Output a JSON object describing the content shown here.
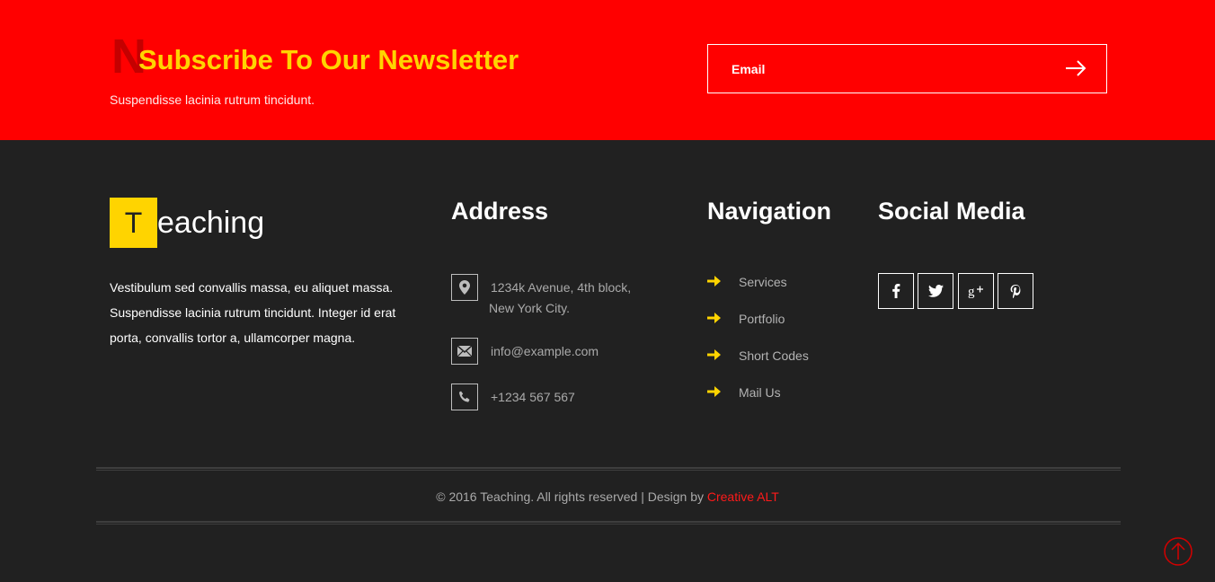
{
  "newsletter": {
    "big_letter": "N",
    "title": "Subscribe To Our Newsletter",
    "subtitle": "Suspendisse lacinia rutrum tincidunt.",
    "email_placeholder": "Email",
    "submit_icon": "arrow-right-icon"
  },
  "brand": {
    "logo_letter": "T",
    "logo_rest": "eaching",
    "description": "Vestibulum sed convallis massa, eu aliquet massa. Suspendisse lacinia rutrum tincidunt. Integer id erat porta, convallis tortor a, ullamcorper magna."
  },
  "address": {
    "title": "Address",
    "location_line1": "1234k Avenue, 4th block,",
    "location_line2": "New York City.",
    "email": "info@example.com",
    "phone": "+1234 567 567"
  },
  "navigation": {
    "title": "Navigation",
    "items": [
      "Services",
      "Portfolio",
      "Short Codes",
      "Mail Us"
    ]
  },
  "social": {
    "title": "Social Media",
    "icons": [
      "facebook-icon",
      "twitter-icon",
      "google-plus-icon",
      "pinterest-icon"
    ]
  },
  "footer": {
    "copyright_text": "© 2016 Teaching. All rights reserved | Design by ",
    "designer_link": "Creative ALT"
  },
  "colors": {
    "newsletter_bg": "#ff0000",
    "accent_yellow": "#ffd400",
    "footer_bg": "#212121",
    "link_red": "#ff1a1a"
  }
}
